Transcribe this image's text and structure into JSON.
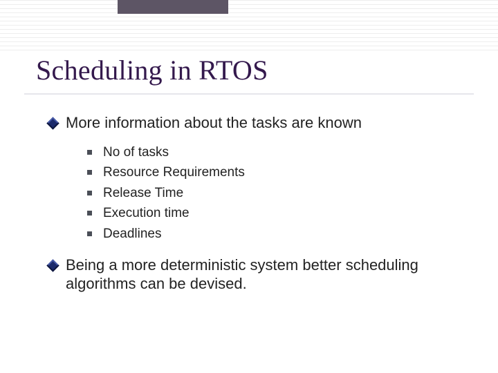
{
  "title": "Scheduling in RTOS",
  "bullets": [
    {
      "text": "More information about the tasks are known",
      "sub": [
        "No of tasks",
        "Resource Requirements",
        "Release Time",
        "Execution time",
        "Deadlines"
      ]
    },
    {
      "text": "Being a more deterministic system better scheduling algorithms can be devised."
    }
  ]
}
